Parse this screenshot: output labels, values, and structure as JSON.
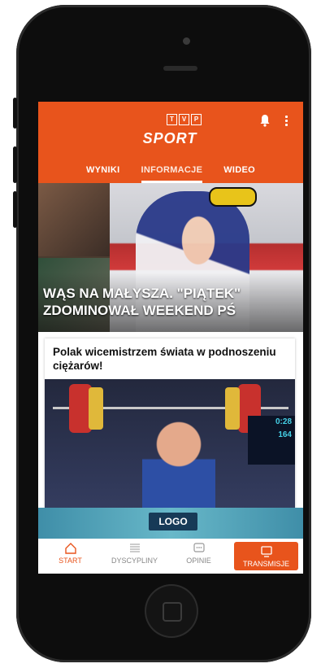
{
  "app": {
    "logo_letters": [
      "T",
      "V",
      "P"
    ],
    "brand": "SPORT",
    "accent_color": "#e8541c",
    "icons": {
      "notifications": "bell-icon",
      "menu": "kebab-menu-icon"
    }
  },
  "tabs": [
    {
      "label": "WYNIKI",
      "active": false
    },
    {
      "label": "INFORMACJE",
      "active": true
    },
    {
      "label": "WIDEO",
      "active": false
    }
  ],
  "hero": {
    "title": "WĄS NA MAŁYSZA. \"PIĄTEK\" ZDOMINOWAŁ WEEKEND PŚ"
  },
  "article": {
    "headline": "Polak wicemistrzem świata w podnoszeniu ciężarów!",
    "scoreboard": [
      "0:28",
      "164"
    ]
  },
  "ad_banner": {
    "label": "LOGO"
  },
  "bottom_nav": [
    {
      "label": "START",
      "icon": "home-icon",
      "active": true
    },
    {
      "label": "DYSCYPLINY",
      "icon": "list-icon",
      "active": false
    },
    {
      "label": "OPINIE",
      "icon": "chat-bubble-icon",
      "active": false
    },
    {
      "label": "TRANSMISJE",
      "icon": "monitor-icon",
      "active": false
    }
  ]
}
